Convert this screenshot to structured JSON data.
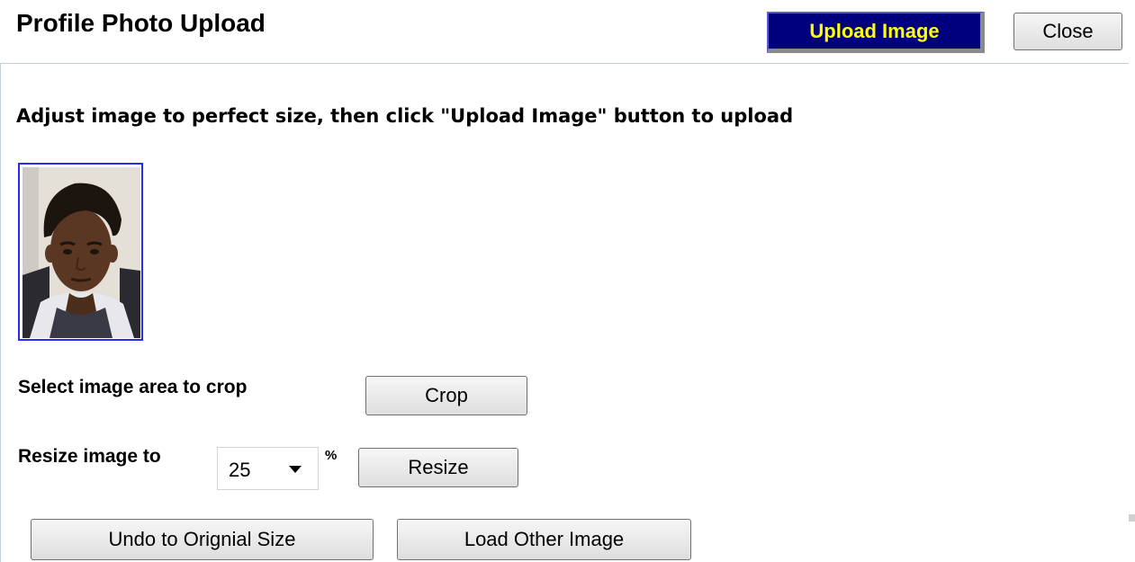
{
  "dialog": {
    "title": "Profile Photo Upload",
    "upload_label": "Upload Image",
    "close_label": "Close"
  },
  "instruction": "Adjust image to perfect size, then click \"Upload Image\" button to upload",
  "crop": {
    "label": "Select image area to crop",
    "button_label": "Crop"
  },
  "resize": {
    "label": "Resize image to",
    "selected_value": "25",
    "unit": "%",
    "button_label": "Resize"
  },
  "actions": {
    "undo_label": "Undo to Orignial Size",
    "load_other_label": "Load Other Image"
  },
  "colors": {
    "upload_button_bg": "#00007c",
    "upload_button_text": "#ffff00",
    "photo_border": "#2a2af0",
    "divider": "#c3cddd"
  }
}
